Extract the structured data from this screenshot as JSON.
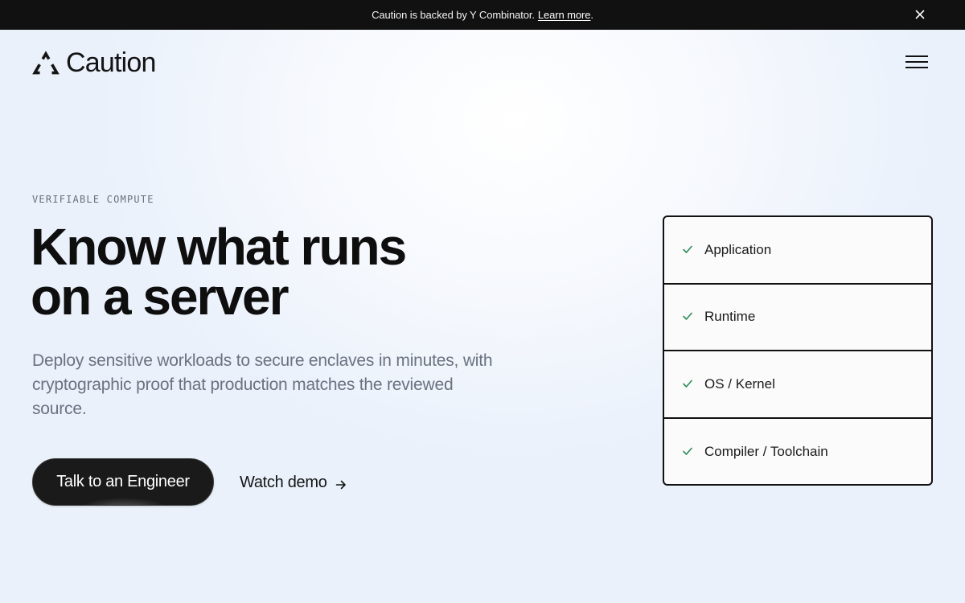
{
  "announcement": {
    "text": "Caution is backed by Y Combinator.",
    "link_label": "Learn more",
    "suffix": ".",
    "close_icon": "close-icon"
  },
  "header": {
    "logo_icon": "triangle-logo-icon",
    "brand_name": "Caution",
    "menu_icon": "hamburger-menu-icon"
  },
  "hero": {
    "eyebrow": "VERIFIABLE COMPUTE",
    "headline_line1": "Know what runs",
    "headline_line2": "on a server",
    "subhead": "Deploy sensitive workloads to secure enclaves in minutes, with cryptographic proof that production matches the reviewed source.",
    "primary_cta": "Talk to an Engineer",
    "secondary_cta": "Watch demo",
    "secondary_cta_icon": "arrow-right-icon"
  },
  "stack": {
    "check_icon": "check-icon",
    "items": [
      {
        "label": "Application"
      },
      {
        "label": "Runtime"
      },
      {
        "label": "OS / Kernel"
      },
      {
        "label": "Compiler / Toolchain"
      }
    ]
  },
  "colors": {
    "announcement_bg": "#111111",
    "check_green": "#2e8b57",
    "primary_button": "#1b1b1b",
    "subhead_text": "#6b7280"
  }
}
